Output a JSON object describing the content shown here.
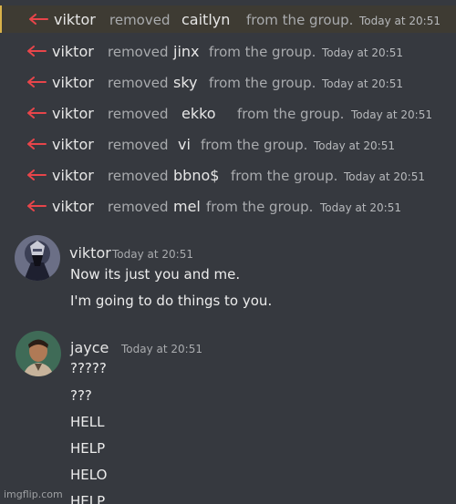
{
  "colors": {
    "background": "#36393f",
    "arrow": "#e8454a",
    "highlight_row": "#3e3b33",
    "highlight_border": "#d9b24a"
  },
  "system_messages": [
    {
      "actor": "viktor",
      "action": "removed",
      "target": "caitlyn",
      "tail": "from the group.",
      "time": "Today at 20:51"
    },
    {
      "actor": "viktor",
      "action": "removed",
      "target": "jinx",
      "tail": "from the group.",
      "time": "Today at 20:51"
    },
    {
      "actor": "viktor",
      "action": "removed",
      "target": "sky",
      "tail": "from the group.",
      "time": "Today at 20:51"
    },
    {
      "actor": "viktor",
      "action": "removed",
      "target": "ekko",
      "tail": "from the group.",
      "time": "Today at 20:51"
    },
    {
      "actor": "viktor",
      "action": "removed",
      "target": "vi",
      "tail": "from the group.",
      "time": "Today at 20:51"
    },
    {
      "actor": "viktor",
      "action": "removed",
      "target": "bbno$",
      "tail": "from the group.",
      "time": "Today at 20:51"
    },
    {
      "actor": "viktor",
      "action": "removed",
      "target": "mel",
      "tail": "from the group.",
      "time": "Today at 20:51"
    }
  ],
  "messages": [
    {
      "author": "viktor",
      "time": "Today at 20:51",
      "avatar_icon": "masked-figure-avatar",
      "lines": [
        "Now its just you and me.",
        "I'm going to do things to you."
      ]
    },
    {
      "author": "jayce",
      "time": "Today at 20:51",
      "avatar_icon": "man-portrait-avatar",
      "lines": [
        "?????",
        "???",
        "HELL",
        "HELP",
        "HELO",
        "HELP"
      ]
    }
  ],
  "watermark": "imgflip.com"
}
